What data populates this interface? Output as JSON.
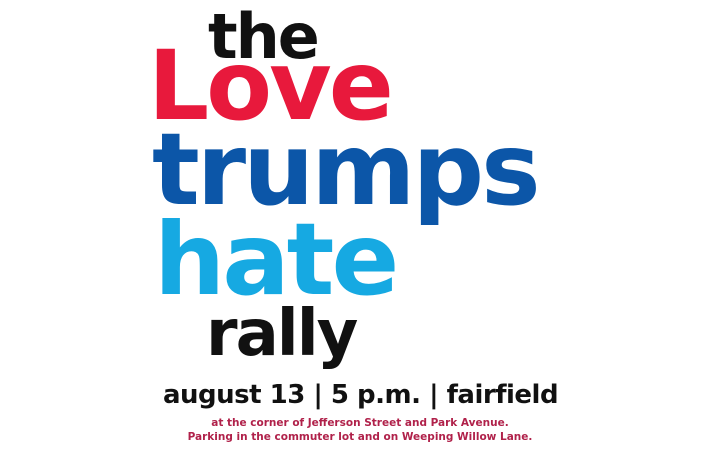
{
  "poster": {
    "line_the": "the",
    "line_love": "Love",
    "line_trumps": "trumps",
    "line_hate": "hate",
    "line_rally": "rally",
    "details": "august 13 | 5 p.m. | fairfield",
    "location_line1": "at the corner of  Jefferson Street and Park Avenue.",
    "location_line2": "Parking in the commuter lot and on Weeping Willow Lane."
  },
  "colors": {
    "black": "#111111",
    "red": "#e8193c",
    "dark_blue": "#0c56a8",
    "light_blue": "#16a9e2",
    "crimson": "#b0214a"
  }
}
